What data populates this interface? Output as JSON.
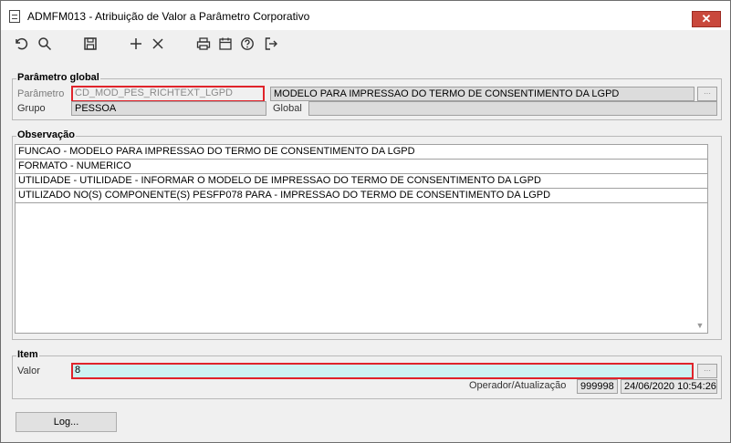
{
  "window": {
    "title": "ADMFM013 - Atribuição de Valor a Parâmetro Corporativo",
    "close_label": "✕"
  },
  "toolbar": {
    "icons": [
      "undo-icon",
      "search-icon",
      "save-icon",
      "add-icon",
      "delete-icon",
      "print-icon",
      "calendar-icon",
      "help-icon",
      "exit-icon"
    ]
  },
  "parametro_global": {
    "section_label": "Parâmetro global",
    "parametro_label": "Parâmetro",
    "parametro_value": "CD_MOD_PES_RICHTEXT_LGPD",
    "parametro_desc": "MODELO PARA IMPRESSAO DO TERMO DE CONSENTIMENTO DA LGPD",
    "grupo_label": "Grupo",
    "grupo_value": "PESSOA",
    "global_label": "Global",
    "global_value": ""
  },
  "observacao": {
    "section_label": "Observação",
    "lines": [
      "FUNCAO - MODELO PARA IMPRESSAO DO TERMO DE CONSENTIMENTO DA LGPD",
      "FORMATO - NUMERICO",
      "UTILIDADE - UTILIDADE - INFORMAR O MODELO DE IMPRESSAO DO TERMO DE CONSENTIMENTO DA LGPD",
      "UTILIZADO NO(S) COMPONENTE(S) PESFP078 PARA  - IMPRESSAO DO TERMO DE CONSENTIMENTO DA LGPD"
    ]
  },
  "item": {
    "section_label": "Item",
    "valor_label": "Valor",
    "valor_value": "8",
    "operador_label": "Operador/Atualização",
    "operador_value": "999998",
    "atualizacao_value": "24/06/2020 10:54:26"
  },
  "footer": {
    "log_button": "Log..."
  }
}
